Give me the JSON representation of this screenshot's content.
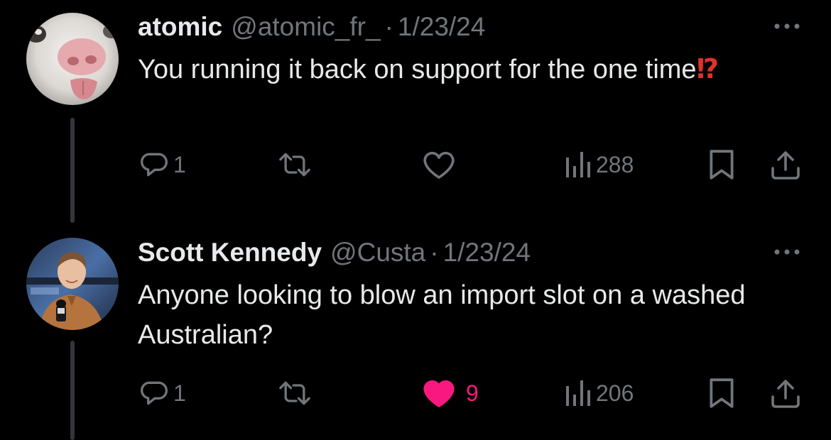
{
  "tweets": [
    {
      "display_name": "atomic",
      "handle": "@atomic_fr_",
      "separator": "·",
      "date": "1/23/24",
      "text": "You running it back on support for the one time",
      "emoji": "⁉",
      "replies": "1",
      "retweets": "",
      "likes": "",
      "liked": false,
      "views": "288"
    },
    {
      "display_name": "Scott Kennedy",
      "handle": "@Custa",
      "separator": "·",
      "date": "1/23/24",
      "text": "Anyone looking to blow an import slot on a washed Australian?",
      "replies": "1",
      "retweets": "",
      "likes": "9",
      "liked": true,
      "views": "206"
    }
  ],
  "colors": {
    "background": "#000000",
    "text_primary": "#e7e9ea",
    "text_secondary": "#71767b",
    "like_active": "#f91880",
    "thread_line": "#333639"
  },
  "icons": [
    "more-icon",
    "reply-icon",
    "retweet-icon",
    "like-icon",
    "views-icon",
    "bookmark-icon",
    "share-icon"
  ]
}
